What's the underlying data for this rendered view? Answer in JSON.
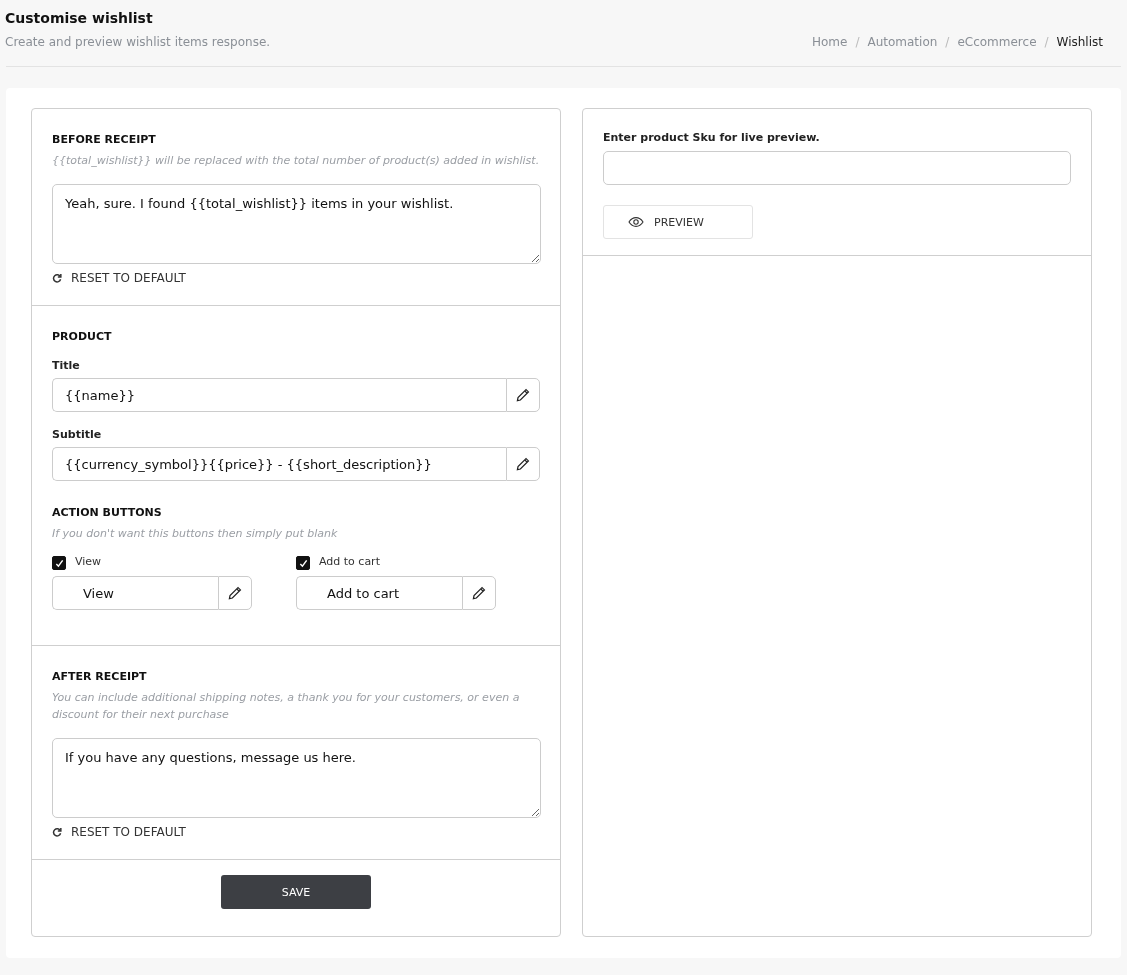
{
  "header": {
    "title": "Customise wishlist",
    "subtitle": "Create and preview wishlist items response."
  },
  "breadcrumb": [
    "Home",
    "Automation",
    "eCcommerce",
    "Wishlist"
  ],
  "breadcrumb_separator": "/",
  "before_receipt": {
    "heading": "BEFORE RECEIPT",
    "hint": "{{total_wishlist}} will be replaced with the total number of product(s) added in wishlist.",
    "value": "Yeah, sure. I found {{total_wishlist}} items in your wishlist.",
    "reset": "RESET TO DEFAULT"
  },
  "product": {
    "heading": "PRODUCT",
    "fields": [
      {
        "label": "Title",
        "value": "{{name}}"
      },
      {
        "label": "Subtitle",
        "value": "{{currency_symbol}}{{price}} - {{short_description}}"
      }
    ]
  },
  "action_buttons": {
    "heading": "ACTION BUTTONS",
    "hint": "If you don't want this buttons then simply put blank",
    "items": [
      {
        "label": "View",
        "checked": true,
        "value": "View"
      },
      {
        "label": "Add to cart",
        "checked": true,
        "value": "Add to cart"
      }
    ]
  },
  "after_receipt": {
    "heading": "AFTER RECEIPT",
    "hint": "You can include additional shipping notes, a thank you for your customers, or even a discount for their next purchase",
    "value": "If you have any questions, message us here.",
    "reset": "RESET TO DEFAULT"
  },
  "save": "SAVE",
  "preview": {
    "label": "Enter product Sku for live preview.",
    "button": "PREVIEW"
  }
}
